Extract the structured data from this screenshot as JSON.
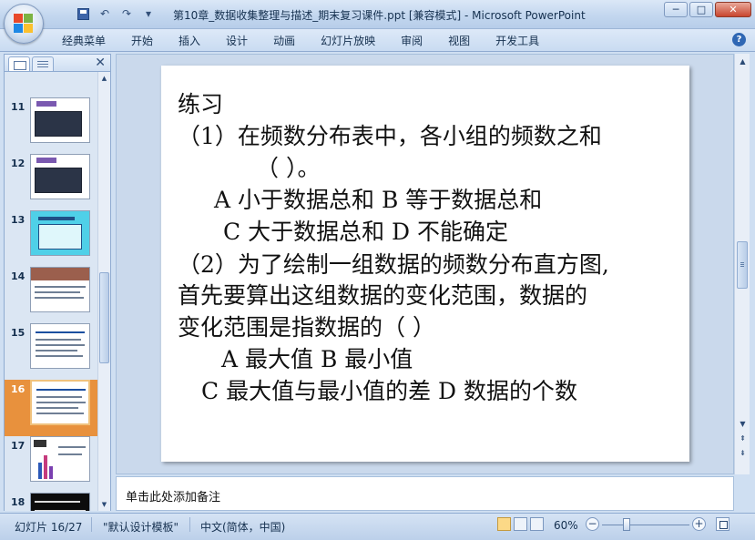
{
  "window": {
    "title": "第10章_数据收集整理与描述_期末复习课件.ppt [兼容模式] - Microsoft PowerPoint",
    "controls": [
      "─",
      "□",
      "✕"
    ]
  },
  "qat": {
    "undo": "↶",
    "redo": "↷",
    "more": "▾"
  },
  "ribbon": {
    "tabs": [
      "经典菜单",
      "开始",
      "插入",
      "设计",
      "动画",
      "幻灯片放映",
      "审阅",
      "视图",
      "开发工具"
    ],
    "help": "?"
  },
  "panel": {
    "close": "✕",
    "thumbnails": [
      {
        "num": "11",
        "style": "table"
      },
      {
        "num": "12",
        "style": "table"
      },
      {
        "num": "13",
        "style": "chart"
      },
      {
        "num": "14",
        "style": "photo"
      },
      {
        "num": "15",
        "style": "text"
      },
      {
        "num": "16",
        "style": "text",
        "selected": true
      },
      {
        "num": "17",
        "style": "bars"
      },
      {
        "num": "18",
        "style": "dark"
      }
    ]
  },
  "slide": {
    "lines": [
      "练习",
      "（1）在频数分布表中，各小组的频数之和",
      "（    ）。",
      "A  小于数据总和        B  等于数据总和",
      "C  大于数据总和        D  不能确定",
      "（2）为了绘制一组数据的频数分布直方图,",
      "首先要算出这组数据的变化范围，数据的",
      "变化范围是指数据的（      ）",
      "A  最大值           B  最小值",
      "C  最大值与最小值的差    D 数据的个数"
    ]
  },
  "notes": {
    "placeholder": "单击此处添加备注"
  },
  "status": {
    "slide_info": "幻灯片 16/27",
    "theme": "\"默认设计模板\"",
    "language": "中文(简体，中国)",
    "zoom": "60%",
    "zoom_minus": "−",
    "zoom_plus": "+"
  }
}
